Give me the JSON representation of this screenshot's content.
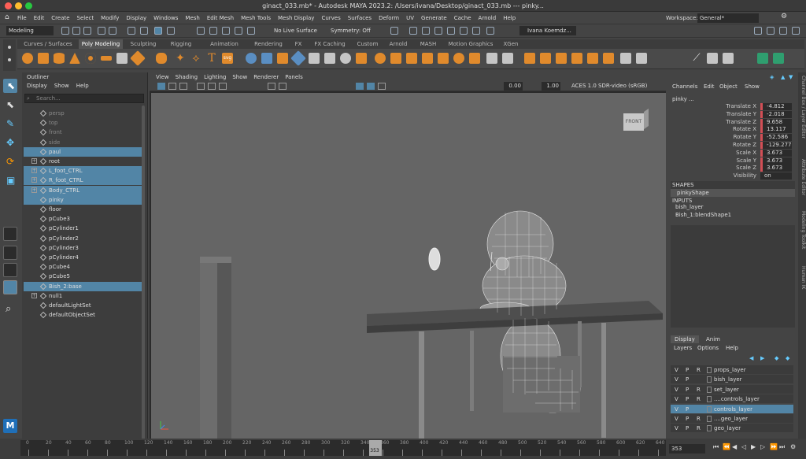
{
  "window": {
    "title": "ginact_033.mb* - Autodesk MAYA 2023.2: /Users/ivana/Desktop/ginact_033.mb  ---  pinky..."
  },
  "menu": [
    "File",
    "Edit",
    "Create",
    "Select",
    "Modify",
    "Display",
    "Windows",
    "Mesh",
    "Edit Mesh",
    "Mesh Tools",
    "Mesh Display",
    "Curves",
    "Surfaces",
    "Deform",
    "UV",
    "Generate",
    "Cache",
    "Arnold",
    "Help"
  ],
  "workspace": {
    "label": "Workspace:",
    "value": "General*"
  },
  "status": {
    "mode": "Modeling",
    "live_surface": "No Live Surface",
    "symmetry": "Symmetry: Off",
    "user": "Ivana Koemdz..."
  },
  "shelf_tabs": [
    "Curves / Surfaces",
    "Poly Modeling",
    "Sculpting",
    "Rigging",
    "Animation",
    "Rendering",
    "FX",
    "FX Caching",
    "Custom",
    "Arnold",
    "MASH",
    "Motion Graphics",
    "XGen"
  ],
  "shelf_active": "Poly Modeling",
  "outliner": {
    "title": "Outliner",
    "menu": [
      "Display",
      "Show",
      "Help"
    ],
    "search_placeholder": "Search...",
    "items": [
      {
        "label": "persp",
        "dim": true
      },
      {
        "label": "top",
        "dim": true
      },
      {
        "label": "front",
        "dim": true
      },
      {
        "label": "side",
        "dim": true
      },
      {
        "label": "paul",
        "sel": true
      },
      {
        "label": "root",
        "exp": true
      },
      {
        "label": "L_foot_CTRL",
        "sel": true,
        "exp": true
      },
      {
        "label": "R_foot_CTRL",
        "sel": true,
        "exp": true
      },
      {
        "label": "Body_CTRL",
        "sel": true,
        "exp": true
      },
      {
        "label": "pinky",
        "sel": true
      },
      {
        "label": "floor"
      },
      {
        "label": "pCube3"
      },
      {
        "label": "pCylinder1"
      },
      {
        "label": "pCylinder2"
      },
      {
        "label": "pCylinder3"
      },
      {
        "label": "pCylinder4"
      },
      {
        "label": "pCube4"
      },
      {
        "label": "pCube5"
      },
      {
        "label": "Bish_2:base",
        "sel": true
      },
      {
        "label": "null1",
        "exp": true
      },
      {
        "label": "defaultLightSet"
      },
      {
        "label": "defaultObjectSet"
      }
    ]
  },
  "viewport": {
    "menu": [
      "View",
      "Shading",
      "Lighting",
      "Show",
      "Renderer",
      "Panels"
    ],
    "val1": "0.00",
    "val2": "1.00",
    "colorspace": "ACES 1.0 SDR-video (sRGB)",
    "cube_label": "FRONT"
  },
  "channelbox": {
    "menu": [
      "Channels",
      "Edit",
      "Object",
      "Show"
    ],
    "object": "pinky ...",
    "attrs": [
      {
        "name": "Translate X",
        "value": "-4.812",
        "red": true
      },
      {
        "name": "Translate Y",
        "value": "-2.018",
        "red": true
      },
      {
        "name": "Translate Z",
        "value": "9.658",
        "red": true
      },
      {
        "name": "Rotate X",
        "value": "13.117",
        "red": true
      },
      {
        "name": "Rotate Y",
        "value": "-52.586",
        "red": true
      },
      {
        "name": "Rotate Z",
        "value": "-129.277",
        "red": true
      },
      {
        "name": "Scale X",
        "value": "3.673",
        "red": true
      },
      {
        "name": "Scale Y",
        "value": "3.673",
        "red": true
      },
      {
        "name": "Scale Z",
        "value": "3.673",
        "red": true
      },
      {
        "name": "Visibility",
        "value": "on",
        "red": false
      }
    ],
    "shapes_header": "SHAPES",
    "shape": "pinkyShape",
    "inputs_header": "INPUTS",
    "inputs": [
      "bish_layer",
      "Bish_1:blendShape1"
    ]
  },
  "layers": {
    "tabs": [
      "Display",
      "Anim"
    ],
    "menu": [
      "Layers",
      "Options",
      "Help"
    ],
    "rows": [
      {
        "v": "V",
        "p": "P",
        "r": "R",
        "name": "props_layer"
      },
      {
        "v": "V",
        "p": "P",
        "r": "",
        "name": "bish_layer"
      },
      {
        "v": "V",
        "p": "P",
        "r": "R",
        "name": "set_layer"
      },
      {
        "v": "V",
        "p": "P",
        "r": "R",
        "name": "....controls_layer"
      },
      {
        "v": "V",
        "p": "P",
        "r": "",
        "name": "controls_layer",
        "sel": true
      },
      {
        "v": "V",
        "p": "P",
        "r": "R",
        "name": "....geo_layer"
      },
      {
        "v": "V",
        "p": "P",
        "r": "R",
        "name": "geo_layer"
      }
    ]
  },
  "side_tabs": [
    "Channel Box / Layer Editor",
    "Attribute Editor",
    "Modeling Toolkit",
    "Human IK"
  ],
  "timeline": {
    "ticks": [
      "0",
      "20",
      "40",
      "60",
      "80",
      "100",
      "120",
      "140",
      "160",
      "180",
      "200",
      "220",
      "240",
      "260",
      "280",
      "300",
      "320",
      "340",
      "360",
      "380",
      "400",
      "420",
      "440",
      "460",
      "480",
      "500",
      "520",
      "540",
      "560",
      "580",
      "600",
      "620",
      "640"
    ],
    "current": "353",
    "field": "353"
  }
}
